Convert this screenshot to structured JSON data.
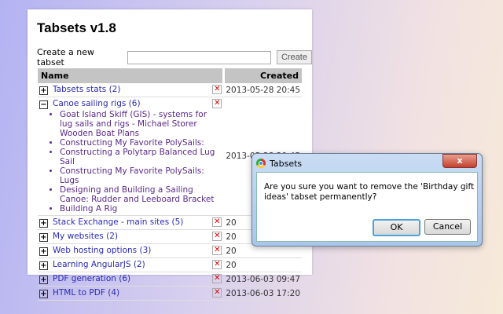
{
  "title": "Tabsets v1.8",
  "create": {
    "label": "Create a new tabset",
    "value": "",
    "button": "Create"
  },
  "table": {
    "headers": {
      "name": "Name",
      "created": "Created"
    },
    "rows": [
      {
        "name": "Tabsets stats (2)",
        "expanded": false,
        "created": "2013-05-28 20:45"
      },
      {
        "name": "Canoe sailing rigs (6)",
        "expanded": true,
        "created": "2013-05-28 20:45",
        "items": [
          "Goat Island Skiff (GIS) - systems for lug sails and rigs - Michael Storer Wooden Boat Plans",
          "Constructing My Favorite PolySails:",
          "Constructing a Polytarp Balanced Lug Sail",
          "Constructing My Favorite PolySails: Lugs",
          "Designing and Building a Sailing Canoe: Rudder and Leeboard Bracket",
          "Building A Rig"
        ]
      },
      {
        "name": "Stack Exchange - main sites (5)",
        "expanded": false,
        "created": "20"
      },
      {
        "name": "My websites (2)",
        "expanded": false,
        "created": "20"
      },
      {
        "name": "Web hosting options (3)",
        "expanded": false,
        "created": "20"
      },
      {
        "name": "Learning AngularJS (2)",
        "expanded": false,
        "created": "20"
      },
      {
        "name": "PDF generation (6)",
        "expanded": false,
        "created": "2013-06-03 09:47"
      },
      {
        "name": "HTML to PDF (4)",
        "expanded": false,
        "created": "2013-06-03 17:20"
      }
    ]
  },
  "dialog": {
    "title": "Tabsets",
    "message": "Are you sure you want to remove the 'Birthday gift ideas' tabset permanently?",
    "ok": "OK",
    "cancel": "Cancel",
    "close": "x"
  }
}
